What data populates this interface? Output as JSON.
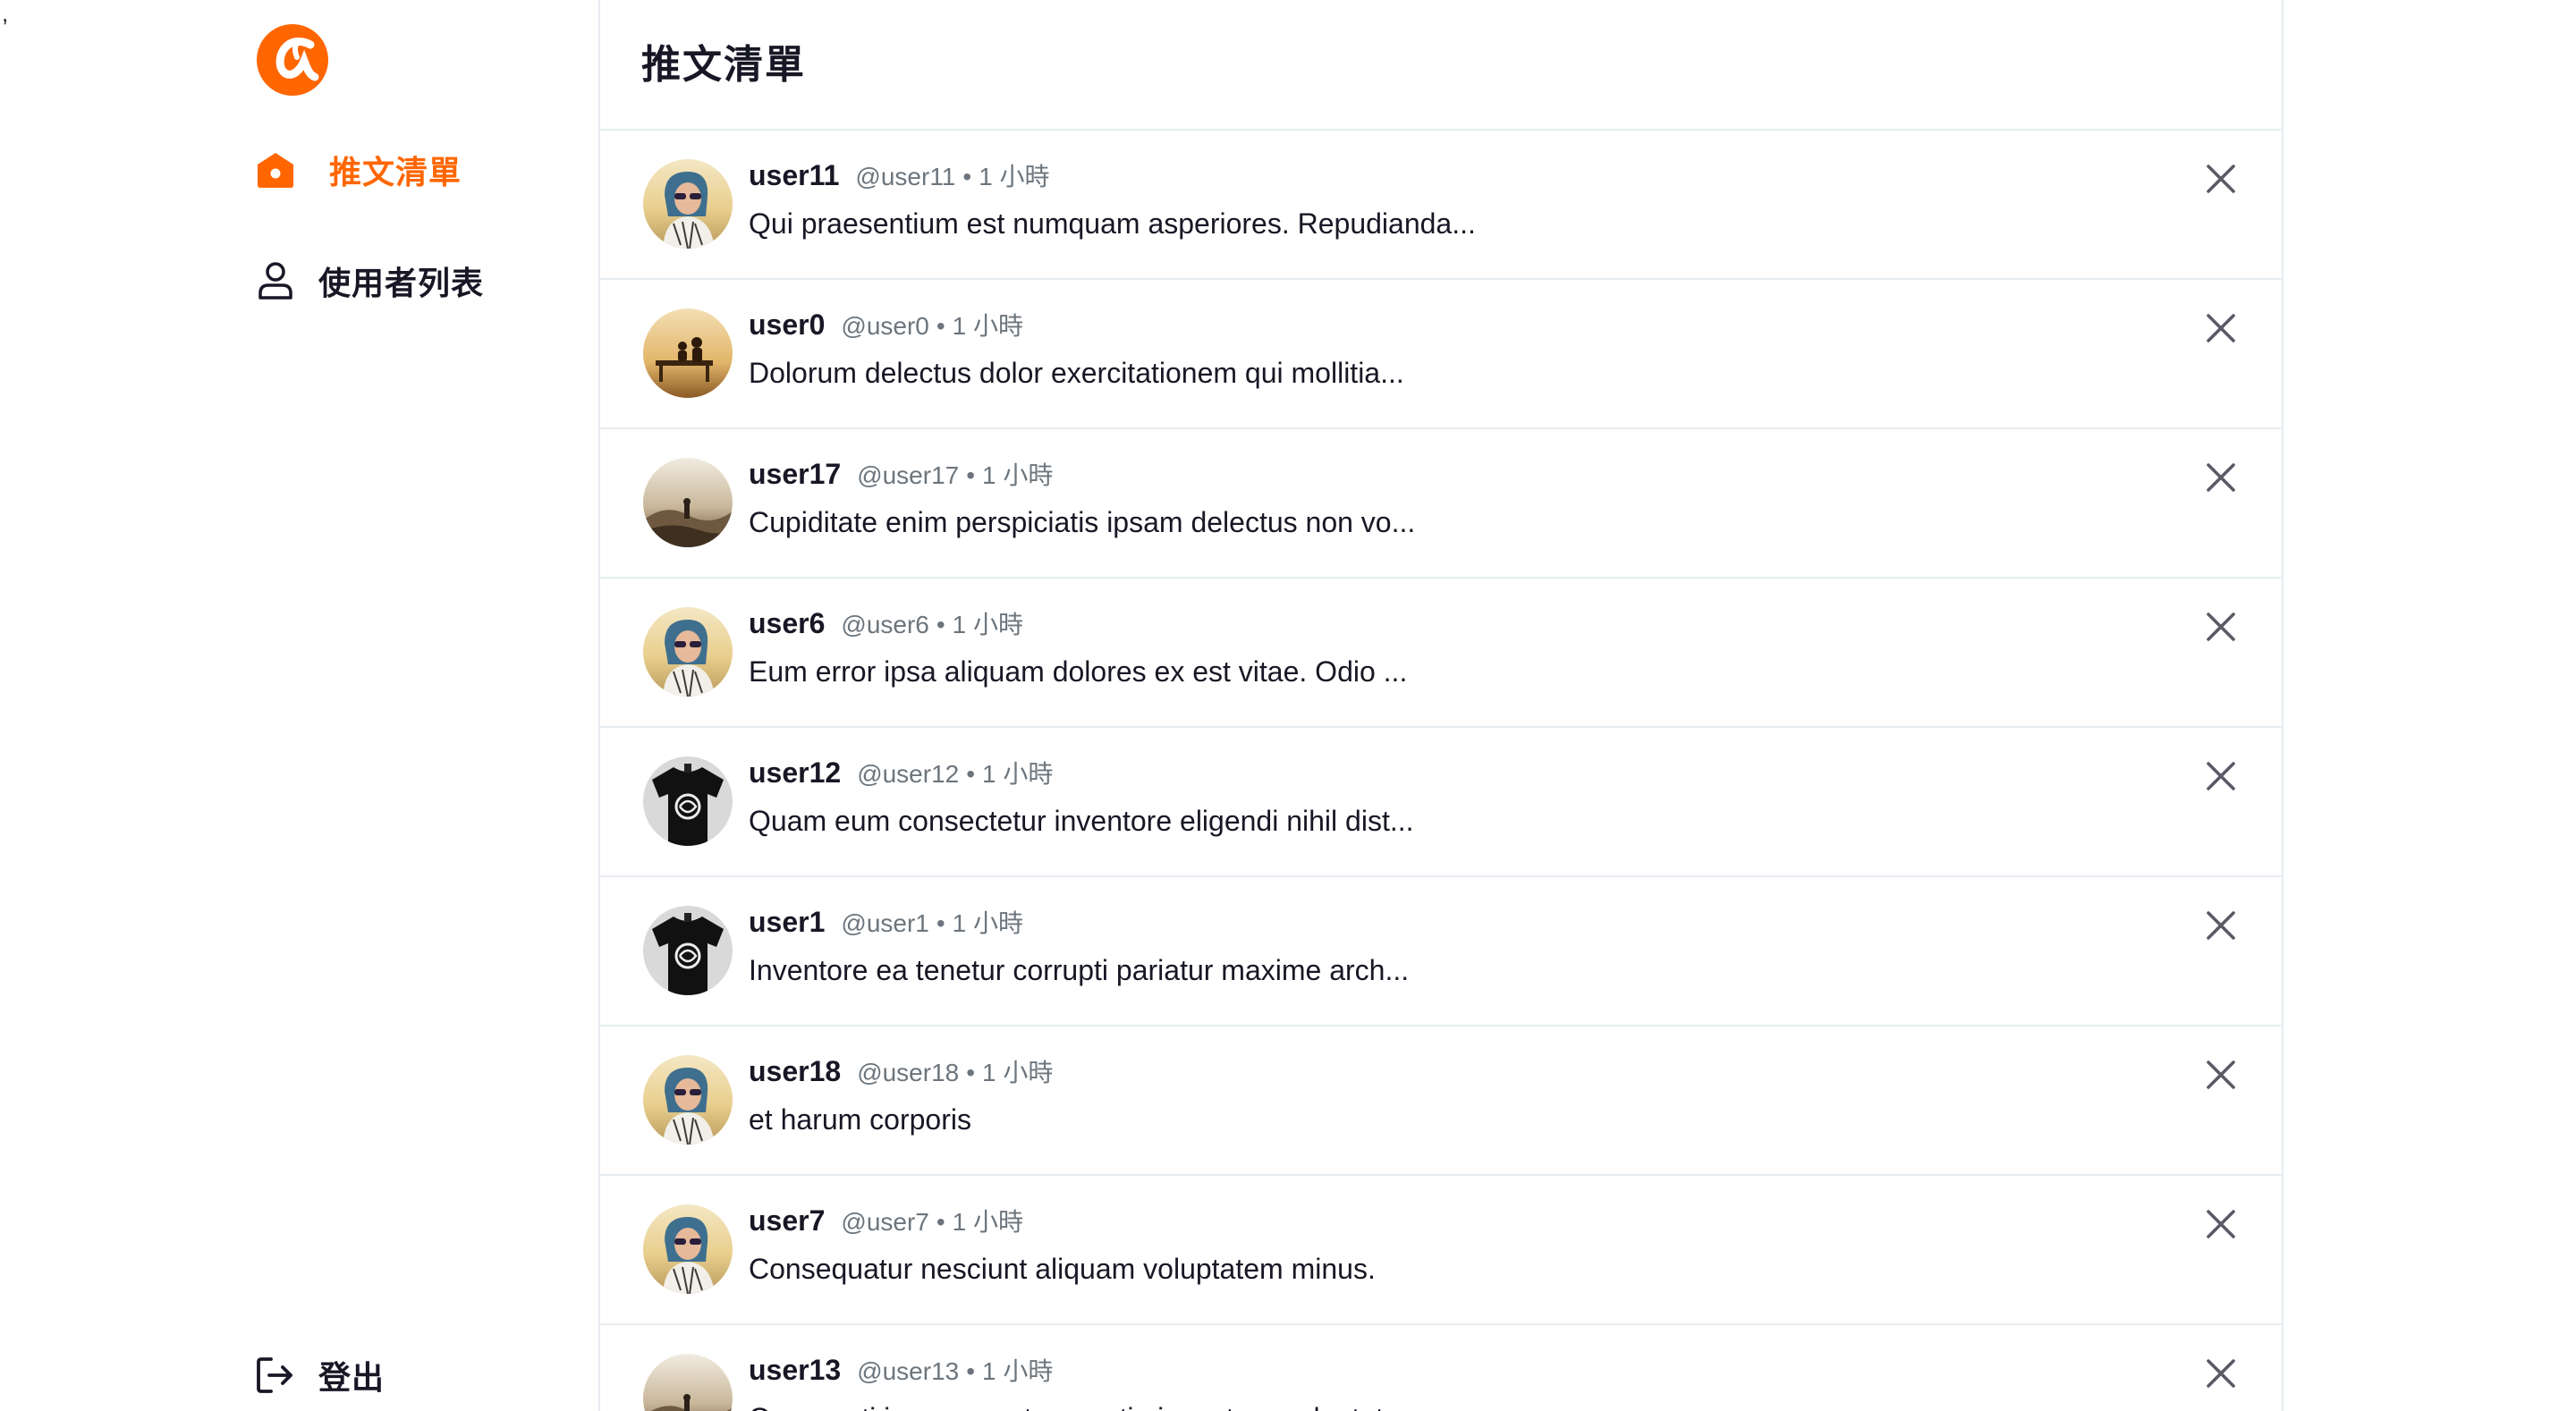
{
  "stray_mark": ",",
  "colors": {
    "brand": "#FF6600",
    "text": "#171725",
    "muted": "#6C757D",
    "divider": "#E6ECF0"
  },
  "sidebar": {
    "logo_icon": "alpha-camp-logo-icon",
    "items": [
      {
        "label": "推文清單",
        "icon": "home-icon",
        "active": true
      },
      {
        "label": "使用者列表",
        "icon": "user-icon",
        "active": false
      }
    ],
    "logout": {
      "label": "登出",
      "icon": "logout-icon"
    }
  },
  "main": {
    "title": "推文清單",
    "tweets": [
      {
        "name": "user11",
        "account": "@user11",
        "dot": "•",
        "time": "1 小時",
        "body": "Qui praesentium est numquam asperiores. Repudianda...",
        "avatar": "woman-sunglasses"
      },
      {
        "name": "user0",
        "account": "@user0",
        "dot": "•",
        "time": "1 小時",
        "body": "Dolorum delectus dolor exercitationem qui mollitia...",
        "avatar": "bench-sunset"
      },
      {
        "name": "user17",
        "account": "@user17",
        "dot": "•",
        "time": "1 小時",
        "body": "Cupiditate enim perspiciatis ipsam delectus non vo...",
        "avatar": "hazy-hills"
      },
      {
        "name": "user6",
        "account": "@user6",
        "dot": "•",
        "time": "1 小時",
        "body": "Eum error ipsa aliquam dolores ex est vitae. Odio ...",
        "avatar": "woman-sunglasses"
      },
      {
        "name": "user12",
        "account": "@user12",
        "dot": "•",
        "time": "1 小時",
        "body": "Quam eum consectetur inventore eligendi nihil dist...",
        "avatar": "black-tshirt"
      },
      {
        "name": "user1",
        "account": "@user1",
        "dot": "•",
        "time": "1 小時",
        "body": "Inventore ea tenetur corrupti pariatur maxime arch...",
        "avatar": "black-tshirt"
      },
      {
        "name": "user18",
        "account": "@user18",
        "dot": "•",
        "time": "1 小時",
        "body": "et harum corporis",
        "avatar": "woman-sunglasses"
      },
      {
        "name": "user7",
        "account": "@user7",
        "dot": "•",
        "time": "1 小時",
        "body": "Consequatur nesciunt aliquam voluptatem minus.",
        "avatar": "woman-sunglasses"
      },
      {
        "name": "user13",
        "account": "@user13",
        "dot": "•",
        "time": "1 小時",
        "body": "Occaecati ipsam ea atque optio inventore voluptate",
        "avatar": "hazy-hills"
      }
    ],
    "delete_icon": "close-icon"
  }
}
